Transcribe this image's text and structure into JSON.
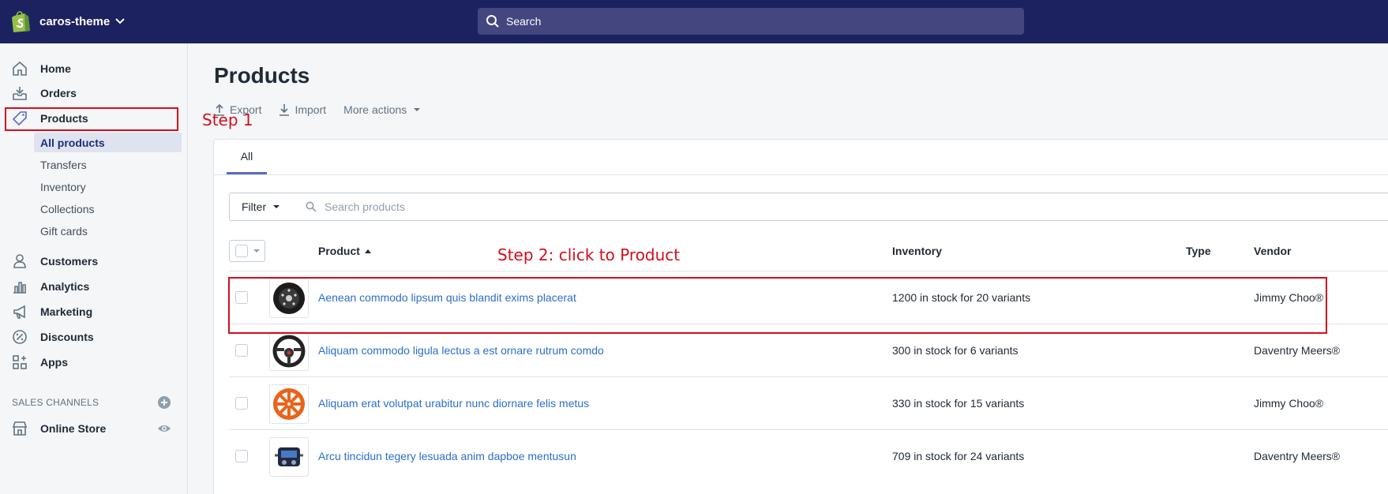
{
  "topbar": {
    "store_name": "caros-theme",
    "search_placeholder": "Search"
  },
  "sidebar": {
    "items": [
      {
        "label": "Home",
        "icon": "home-icon"
      },
      {
        "label": "Orders",
        "icon": "orders-icon"
      },
      {
        "label": "Products",
        "icon": "tag-icon"
      },
      {
        "label": "Customers",
        "icon": "person-icon"
      },
      {
        "label": "Analytics",
        "icon": "bar-chart-icon"
      },
      {
        "label": "Marketing",
        "icon": "megaphone-icon"
      },
      {
        "label": "Discounts",
        "icon": "discount-icon"
      },
      {
        "label": "Apps",
        "icon": "apps-icon"
      }
    ],
    "product_sub_items": [
      "All products",
      "Transfers",
      "Inventory",
      "Collections",
      "Gift cards"
    ],
    "sales_channels_title": "SALES CHANNELS",
    "online_store": "Online Store"
  },
  "main": {
    "title": "Products",
    "actions": {
      "export": "Export",
      "import": "Import",
      "more": "More actions"
    },
    "tabs": [
      "All"
    ],
    "filter_label": "Filter",
    "search_placeholder": "Search products",
    "columns": {
      "product": "Product",
      "inventory": "Inventory",
      "type": "Type",
      "vendor": "Vendor"
    },
    "rows": [
      {
        "name": "Aenean commodo lipsum quis blandit exims placerat",
        "inventory": "1200 in stock for 20 variants",
        "type": "",
        "vendor": "Jimmy Choo®",
        "thumb": "black-wheel"
      },
      {
        "name": "Aliquam commodo ligula lectus a est ornare rutrum comdo",
        "inventory": "300 in stock for 6 variants",
        "type": "",
        "vendor": "Daventry Meers®",
        "thumb": "steering-wheel"
      },
      {
        "name": "Aliquam erat volutpat urabitur nunc diornare felis metus",
        "inventory": "330 in stock for 15 variants",
        "type": "",
        "vendor": "Jimmy Choo®",
        "thumb": "orange-wheel"
      },
      {
        "name": "Arcu tincidun tegery lesuada anim dapboe mentusun",
        "inventory": "709 in stock for 24 variants",
        "type": "",
        "vendor": "Daventry Meers®",
        "thumb": "engine-part"
      }
    ]
  },
  "annotations": {
    "step1": "Step 1",
    "step2": "Step 2: click to Product",
    "color": "#d40e1b"
  },
  "colors": {
    "topbar": "#1c2260",
    "link": "#2c6ecb",
    "accent": "#5c6ac4"
  }
}
